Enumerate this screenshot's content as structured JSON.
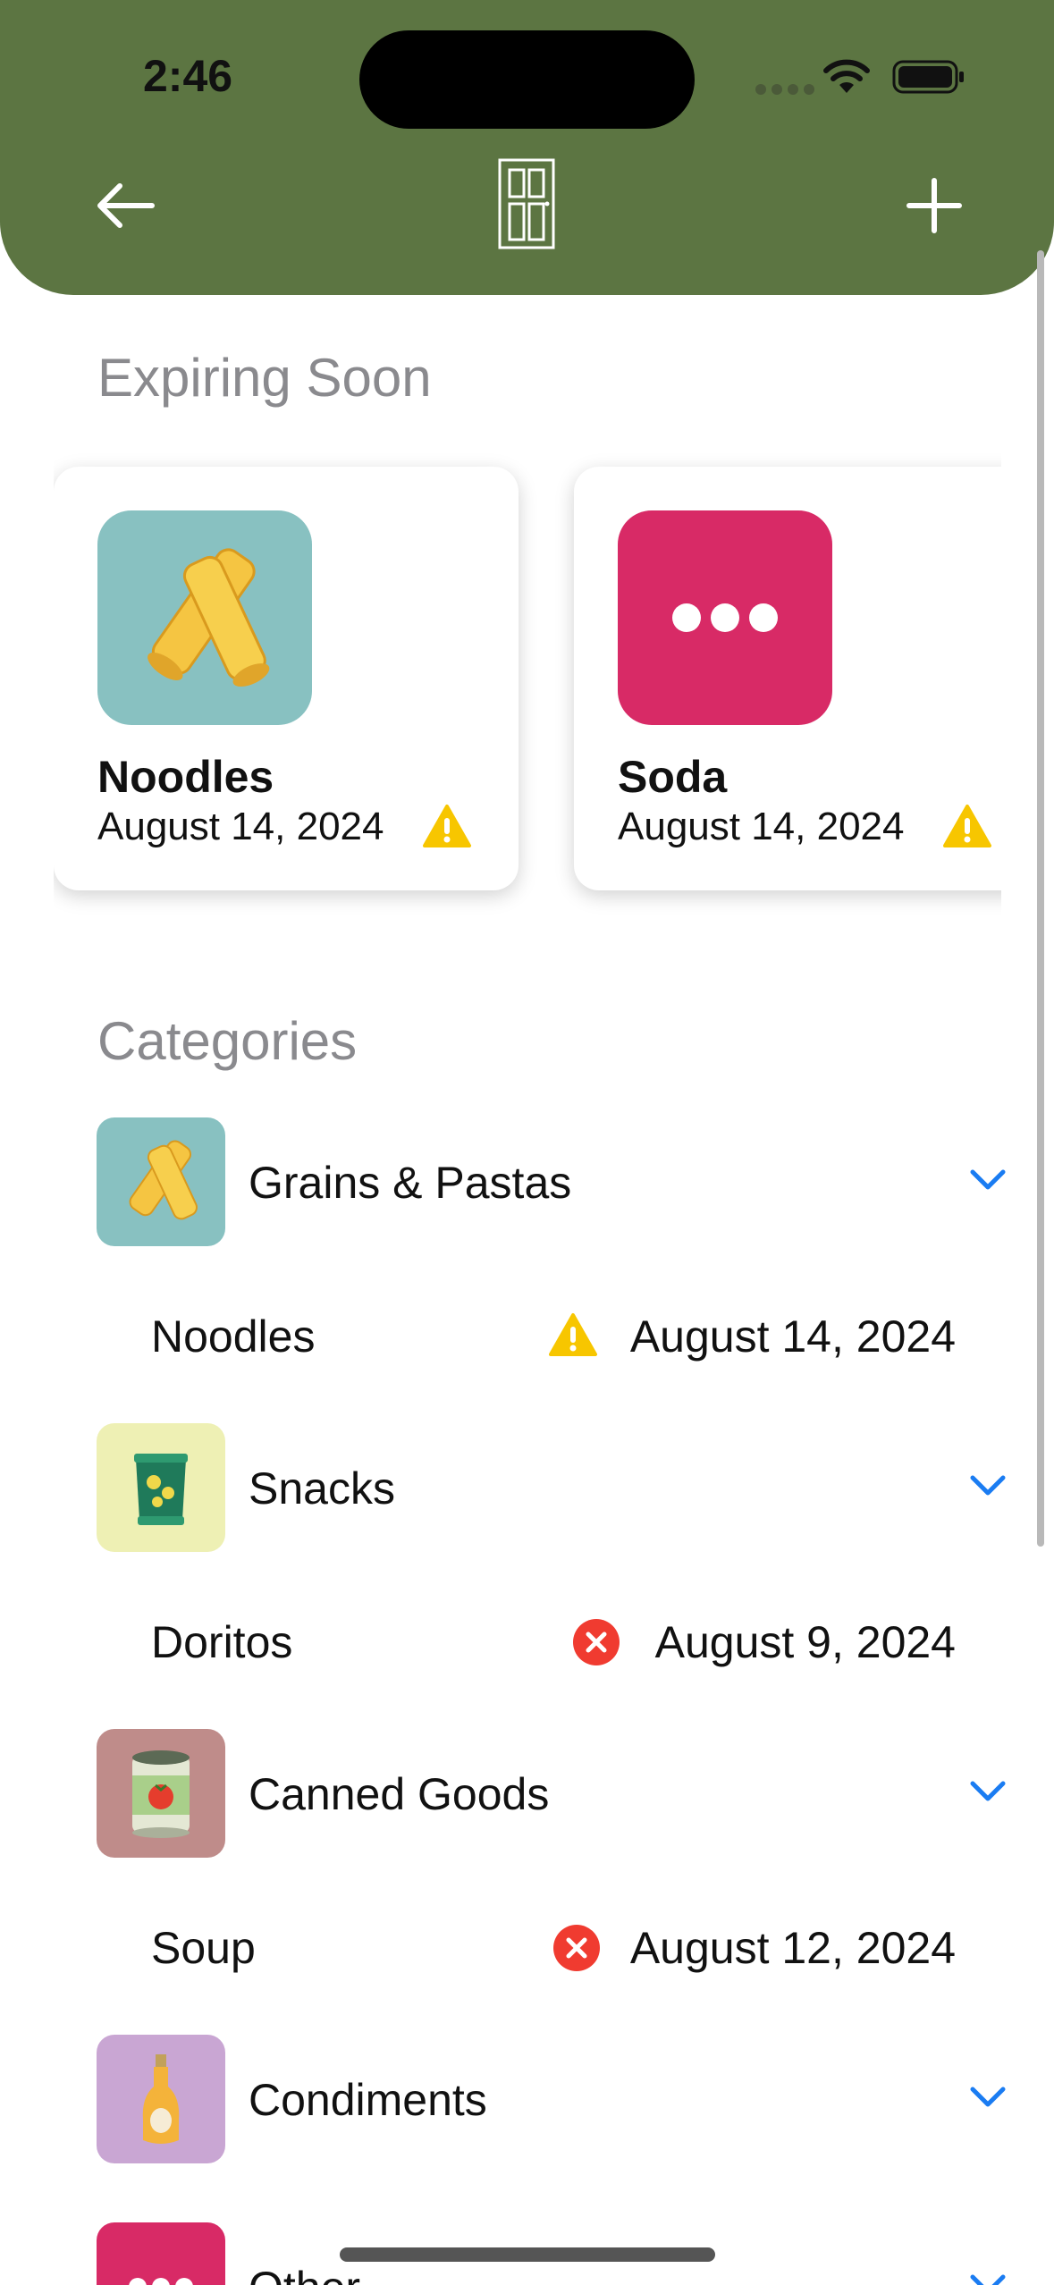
{
  "status_bar": {
    "time": "2:46"
  },
  "header": {
    "back_icon": "arrow-left-icon",
    "logo_icon": "pantry-door-icon",
    "add_icon": "plus-icon",
    "bg_color": "#5c7542"
  },
  "expiring": {
    "title": "Expiring Soon",
    "cards": [
      {
        "name": "Noodles",
        "date": "August 14, 2024",
        "icon": "pasta-icon",
        "status": "warning",
        "bg": "#88c1c1"
      },
      {
        "name": "Soda",
        "date": "August 14, 2024",
        "icon": "more-dots-icon",
        "status": "warning",
        "bg": "#d82a66"
      }
    ]
  },
  "categories": {
    "title": "Categories",
    "groups": [
      {
        "label": "Grains & Pastas",
        "icon": "pasta-icon",
        "bg": "#88c1c1",
        "items": [
          {
            "name": "Noodles",
            "date": "August 14, 2024",
            "status": "warning"
          }
        ]
      },
      {
        "label": "Snacks",
        "icon": "chips-bag-icon",
        "bg": "#eef0b4",
        "items": [
          {
            "name": "Doritos",
            "date": "August 9, 2024",
            "status": "expired"
          }
        ]
      },
      {
        "label": "Canned Goods",
        "icon": "tomato-can-icon",
        "bg": "#bf8c8a",
        "items": [
          {
            "name": "Soup",
            "date": "August 12, 2024",
            "status": "expired"
          }
        ]
      },
      {
        "label": "Condiments",
        "icon": "sauce-bottle-icon",
        "bg": "#c9a6d3",
        "items": []
      },
      {
        "label": "Other",
        "icon": "more-dots-icon",
        "bg": "#d82a66",
        "items": []
      }
    ]
  },
  "colors": {
    "warning": "#f7c600",
    "expired": "#f03b30",
    "chevron": "#1a7cf2",
    "section_title": "#8a8a8e"
  }
}
